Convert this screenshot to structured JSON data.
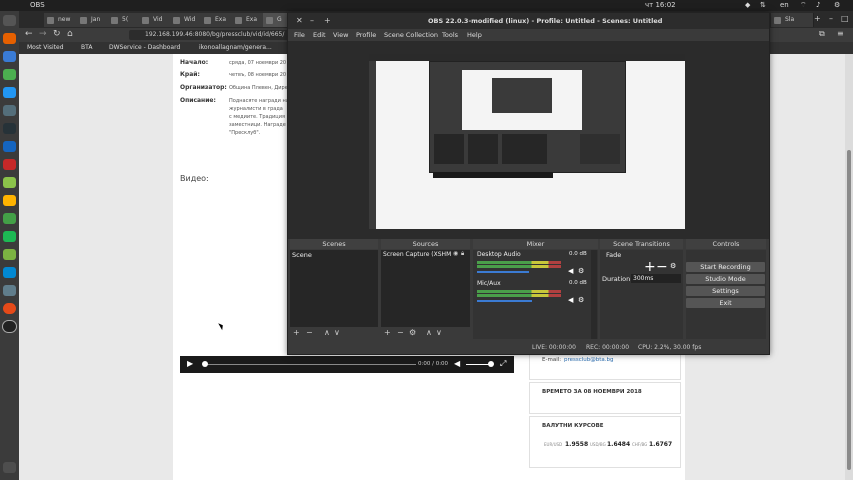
{
  "topbar": {
    "app": "OBS",
    "clock": "чт 16:02",
    "lang": "en"
  },
  "tabs": [
    "new",
    "Jan",
    "5(",
    "Vid",
    "Wid",
    "Exa",
    "Exa",
    "G"
  ],
  "tabs_right": [
    "Sla"
  ],
  "nav": {
    "url": "192.168.199.46:8080/bg/pressclub/vid/id/665/"
  },
  "bookmarks": [
    "Most Visited",
    "BTA",
    "DWService - Dashboard",
    "ikonoallagnam/genera..."
  ],
  "page": {
    "start_label": "Начало:",
    "start_value": "сряда, 07 ноември 20",
    "end_label": "Край:",
    "end_value": "четвъ, 08 ноември 20",
    "org_label": "Организатор:",
    "org_value": "Община Плевен, Дирек",
    "desc_label": "Описание:",
    "desc_lines": [
      "Поднасяте награди на",
      "журналисти в града",
      "с медиите. Традиция",
      "заместници. Награде",
      "\"Пресклуб\"."
    ],
    "video_label": "Видео:",
    "video_time": "0:00 / 0:00",
    "email_label": "E-mail:",
    "email_value": "pressclub@bta.bg",
    "weather_title": "ВРЕМЕТО ЗА 08 НОЕМВРИ 2018",
    "currency_title": "ВАЛУТНИ КУРСОВЕ",
    "currencies": [
      {
        "code": "EUR/USD",
        "value": "1.9558"
      },
      {
        "code": "USD/BG",
        "value": "1.6484"
      },
      {
        "code": "CHF/BG",
        "value": "1.6767"
      }
    ]
  },
  "obs": {
    "title": "OBS 22.0.3-modified (linux) - Profile: Untitled - Scenes: Untitled",
    "menu": [
      "File",
      "Edit",
      "View",
      "Profile",
      "Scene Collection",
      "Tools",
      "Help"
    ],
    "docks": {
      "scenes": "Scenes",
      "sources": "Sources",
      "mixer": "Mixer",
      "transitions": "Scene Transitions",
      "controls": "Controls"
    },
    "scene_item": "Scene",
    "source_item": "Screen Capture (XSHM",
    "mixer": [
      {
        "name": "Desktop Audio",
        "db": "0.0 dB",
        "level": 0.62
      },
      {
        "name": "Mic/Aux",
        "db": "0.0 dB",
        "level": 0.66
      }
    ],
    "transition": "Fade",
    "duration_label": "Duration",
    "duration_value": "300ms",
    "controls": [
      "Start Recording",
      "Studio Mode",
      "Settings",
      "Exit"
    ],
    "status": {
      "live": "LIVE: 00:00:00",
      "rec": "REC: 00:00:00",
      "cpu": "CPU: 2.2%, 30.00 fps"
    }
  }
}
